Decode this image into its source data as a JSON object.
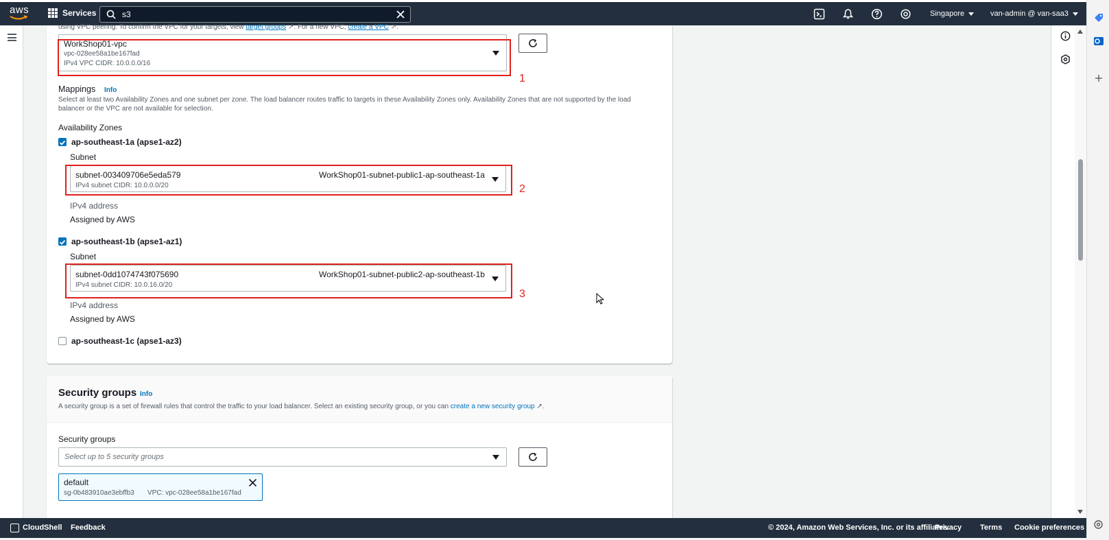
{
  "nav": {
    "services_label": "Services",
    "search_value": "s3",
    "region": "Singapore",
    "account": "van-admin @ van-saa3"
  },
  "vpc": {
    "intro_text_1": "using VPC peering. To confirm the VPC for your targets, view ",
    "target_groups_link": "target groups",
    "intro_text_2": ". For a new VPC, ",
    "create_vpc_link": "create a VPC",
    "intro_text_3": ".",
    "name": "WorkShop01-vpc",
    "id": "vpc-028ee58a1be167fad",
    "cidr": "IPv4 VPC CIDR: 10.0.0.0/16"
  },
  "mappings": {
    "title": "Mappings",
    "info": "Info",
    "description_line1": "Select at least two Availability Zones and one subnet per zone. The load balancer routes traffic to targets in these Availability Zones only. Availability Zones that are not supported by the load",
    "description_line2": "balancer or the VPC are not available for selection.",
    "az_heading": "Availability Zones",
    "zones": [
      {
        "label": "ap-southeast-1a (apse1-az2)",
        "subnet_label": "Subnet",
        "subnet_id": "subnet-003409706e5eda579",
        "subnet_name": "WorkShop01-subnet-public1-ap-southeast-1a",
        "subnet_cidr": "IPv4 subnet CIDR: 10.0.0.0/20",
        "ip_label": "IPv4 address",
        "ip_value": "Assigned by AWS"
      },
      {
        "label": "ap-southeast-1b (apse1-az1)",
        "subnet_label": "Subnet",
        "subnet_id": "subnet-0dd1074743f075690",
        "subnet_name": "WorkShop01-subnet-public2-ap-southeast-1b",
        "subnet_cidr": "IPv4 subnet CIDR: 10.0.16.0/20",
        "ip_label": "IPv4 address",
        "ip_value": "Assigned by AWS"
      },
      {
        "label": "ap-southeast-1c (apse1-az3)"
      }
    ]
  },
  "annotations": [
    "1",
    "2",
    "3"
  ],
  "security_groups": {
    "title": "Security groups",
    "info": "Info",
    "description": "A security group is a set of firewall rules that control the traffic to your load balancer. Select an existing security group, or you can ",
    "create_link": "create a new security group",
    "description_end": ".",
    "field_label": "Security groups",
    "placeholder": "Select up to 5 security groups",
    "token_name": "default",
    "token_id": "sg-0b483910ae3ebffb3",
    "token_vpc": "VPC: vpc-028ee58a1be167fad"
  },
  "footer": {
    "cloudshell": "CloudShell",
    "feedback": "Feedback",
    "copyright": "© 2024, Amazon Web Services, Inc. or its affiliates.",
    "privacy": "Privacy",
    "terms": "Terms",
    "cookies": "Cookie preferences"
  },
  "colors": {
    "nav_bg": "#232f3e",
    "link": "#0073bb",
    "annotation_red": "#e0201b"
  }
}
